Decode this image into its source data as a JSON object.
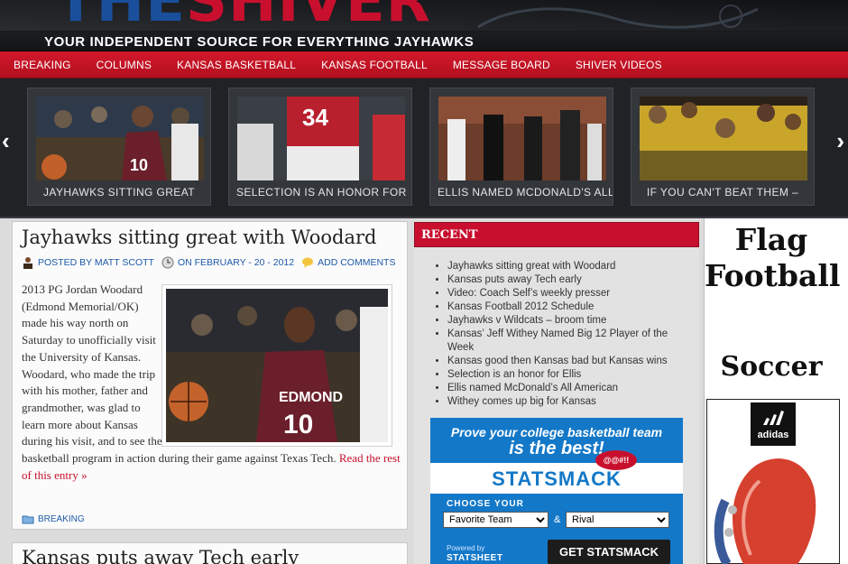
{
  "header": {
    "logo_blue": "THE",
    "logo_red": "SHIVER",
    "tagline": "YOUR INDEPENDENT SOURCE FOR EVERYTHING JAYHAWKS"
  },
  "nav": {
    "items": [
      "BREAKING",
      "COLUMNS",
      "KANSAS BASKETBALL",
      "KANSAS FOOTBALL",
      "MESSAGE BOARD",
      "SHIVER VIDEOS"
    ]
  },
  "slider": {
    "prev_icon": "chevron-left-icon",
    "next_icon": "chevron-right-icon",
    "slides": [
      {
        "caption": "JAYHAWKS SITTING GREAT"
      },
      {
        "caption": "SELECTION IS AN HONOR FOR"
      },
      {
        "caption": "ELLIS NAMED MCDONALD'S ALL"
      },
      {
        "caption": "IF YOU CAN'T BEAT THEM –"
      }
    ]
  },
  "post": {
    "title": "Jayhawks sitting great with Woodard",
    "author": "POSTED BY MATT SCOTT",
    "date": "ON FEBRUARY - 20 - 2012",
    "comments": "ADD COMMENTS",
    "body": "2013 PG Jordan Woodard (Edmond Memorial/OK) made his way north on Saturday to unofficially visit the University of Kansas. Woodard, who made the trip with his mother, father and grandmother, was glad to learn more about Kansas during his visit, and to see the basketball program in action during their game against Texas Tech.",
    "read_more": "Read the rest of this entry »",
    "category": "BREAKING"
  },
  "post2": {
    "title": "Kansas puts away Tech early"
  },
  "recent": {
    "heading": "RECENT",
    "items": [
      "Jayhawks sitting great with Woodard",
      "Kansas puts away Tech early",
      "Video: Coach Self’s weekly presser",
      "Kansas Football 2012 Schedule",
      "Jayhawks v Wildcats – broom time",
      "Kansas’ Jeff Withey Named Big 12 Player of the Week",
      "Kansas good then Kansas bad but Kansas wins",
      "Selection is an honor for Ellis",
      "Ellis named McDonald’s All American",
      "Withey comes up big for Kansas"
    ]
  },
  "ad": {
    "line1": "Prove your college basketball team",
    "line2": "is the best!",
    "logo": "STATSMACK",
    "bubble": "@@#!!",
    "choose": "CHOOSE YOUR",
    "select1": "Favorite Team",
    "amp": "&",
    "select2": "Rival",
    "powered": "Powered by",
    "statsheet": "STATSHEET",
    "button": "GET STATSMACK"
  },
  "ad_right": {
    "flag": "Flag",
    "football": "Football",
    "soccer": "Soccer",
    "brand": "adidas"
  }
}
